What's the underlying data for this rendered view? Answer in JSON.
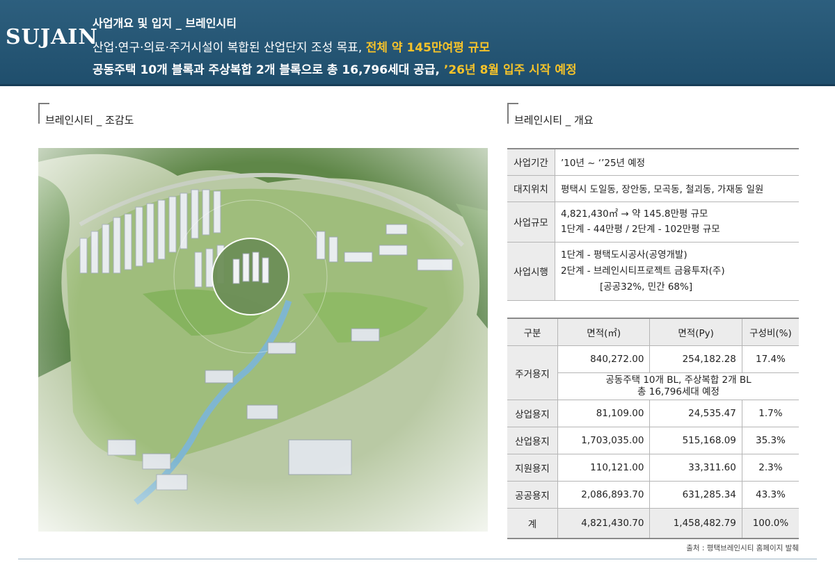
{
  "header": {
    "logo": "SUJAIN",
    "title": "사업개요 및 입지 _ 브레인시티",
    "line1_a": "산업·연구·의료·주거시설이 복합된 산업단지 조성 목표, ",
    "line1_b": "전체 약 145만여평 규모",
    "line2_a": "공동주택 10개 블록과 주상복합 2개 블록으로 총 16,796세대 공급, ",
    "line2_b": "’26년 8월 입주 시작 예정",
    "accent_color": "#f6c32a",
    "banner_color": "#24536f"
  },
  "left_section": {
    "title": "브레인시티 _ 조감도"
  },
  "right_section": {
    "title": "브레인시티 _ 개요"
  },
  "overview": [
    {
      "label": "사업기간",
      "lines": [
        "’10년 ~ ‘’25년 예정"
      ]
    },
    {
      "label": "대지위치",
      "lines": [
        "평택시 도일동, 장안동, 모곡동, 철괴동, 가재동 일원"
      ]
    },
    {
      "label": "사업규모",
      "lines": [
        "4,821,430㎡ → 약 145.8만평 규모",
        "1단계 - 44만평 / 2단계 - 102만평 규모"
      ]
    },
    {
      "label": "사업시행",
      "lines": [
        "1단계 - 평택도시공사(공영개발)",
        "2단계 - 브레인시티프로젝트 금융투자(주)",
        "[공공32%, 민간 68%]"
      ]
    }
  ],
  "land_table": {
    "headers": [
      "구분",
      "면적(㎡)",
      "면적(Py)",
      "구성비(%)"
    ],
    "residential": {
      "label": "주거용지",
      "sqm": "840,272.00",
      "py": "254,182.28",
      "ratio": "17.4%",
      "note1": "공동주택 10개 BL, 주상복합 2개 BL",
      "note2": "총 16,796세대 예정"
    },
    "rows": [
      {
        "label": "상업용지",
        "sqm": "81,109.00",
        "py": "24,535.47",
        "ratio": "1.7%"
      },
      {
        "label": "산업용지",
        "sqm": "1,703,035.00",
        "py": "515,168.09",
        "ratio": "35.3%"
      },
      {
        "label": "지원용지",
        "sqm": "110,121.00",
        "py": "33,311.60",
        "ratio": "2.3%"
      },
      {
        "label": "공공용지",
        "sqm": "2,086,893.70",
        "py": "631,285.34",
        "ratio": "43.3%"
      }
    ],
    "total": {
      "label": "계",
      "sqm": "4,821,430.70",
      "py": "1,458,482.79",
      "ratio": "100.0%"
    }
  },
  "source": "출처 : 평택브레인시티 홈페이지 발췌"
}
